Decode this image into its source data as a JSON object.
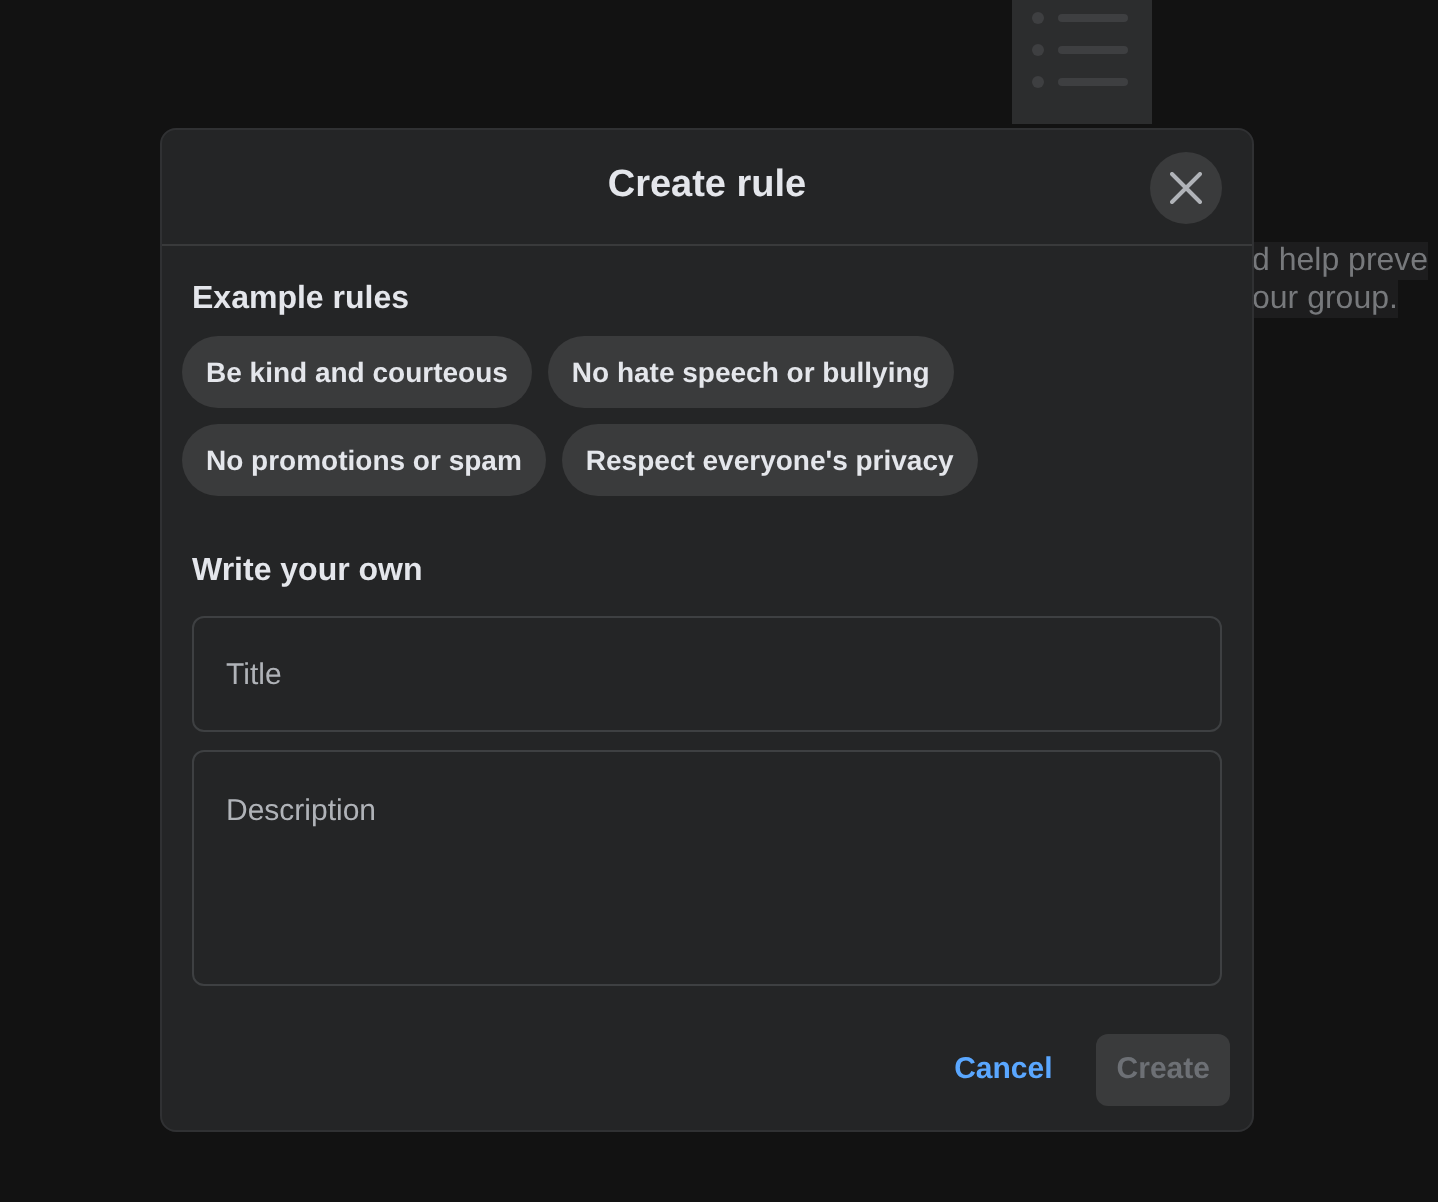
{
  "background": {
    "text_lines": [
      "d help preve",
      "our group."
    ]
  },
  "dialog": {
    "title": "Create rule",
    "examples_heading": "Example rules",
    "example_rules": [
      "Be kind and courteous",
      "No hate speech or bullying",
      "No promotions or spam",
      "Respect everyone's privacy"
    ],
    "own_heading": "Write your own",
    "fields": [
      {
        "kind": "line",
        "placeholder": "Title"
      },
      {
        "kind": "area",
        "placeholder": "Description"
      }
    ],
    "buttons": [
      {
        "kind": "link",
        "label": "Cancel",
        "disabled": false
      },
      {
        "kind": "primary",
        "label": "Create",
        "disabled": true
      }
    ]
  }
}
